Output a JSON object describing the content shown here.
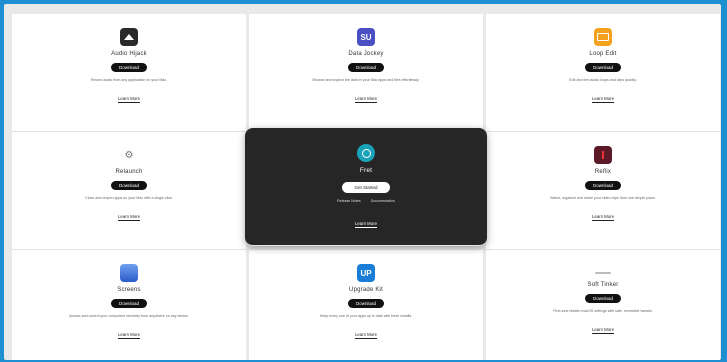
{
  "apps": [
    {
      "name": "Audio Hijack",
      "button": "Download",
      "description": "Record audio from any application on your Mac.",
      "link": "Learn More",
      "logo": "dark-speaker-icon",
      "color": "#2a2a2a"
    },
    {
      "name": "Data Jockey",
      "button": "Download",
      "description": "Browse and inspect the data in your Mac apps and files effortlessly.",
      "link": "Learn More",
      "logo": "su-icon",
      "color": "#4a4fc4",
      "logo_text": "SU"
    },
    {
      "name": "Loop Edit",
      "button": "Download",
      "description": "Edit and trim audio loops and clips quickly.",
      "link": "Learn More",
      "logo": "orange-app-icon",
      "color": "#f3a21e"
    },
    {
      "name": "Relaunch",
      "button": "Download",
      "description": "Close and reopen apps on your Mac with a single click.",
      "link": "Learn More",
      "logo": "crosshair-icon",
      "color": "#888888",
      "logo_text": "⚙"
    },
    {
      "name": "Fret",
      "button": "Get Started",
      "description": "",
      "link": "Learn More",
      "logo": "teal-circle-icon",
      "color": "#1aa3b8",
      "links_row": [
        "Release Notes",
        "Documentation"
      ]
    },
    {
      "name": "Reflix",
      "button": "Download",
      "description": "Watch, organize and share your video clips from one simple place.",
      "link": "Learn More",
      "logo": "red-dark-icon",
      "color": "#5c1a28"
    },
    {
      "name": "Screens",
      "button": "Download",
      "description": "Access and control your computers remotely from anywhere on any device.",
      "link": "Learn More",
      "logo": "blue-gradient-icon",
      "color": "#3a6fd8"
    },
    {
      "name": "Upgrade Kit",
      "button": "Download",
      "description": "Keep every one of your apps up to date with fresh installs.",
      "link": "Learn More",
      "logo": "up-icon",
      "color": "#1a7ed8",
      "logo_text": "UP"
    },
    {
      "name": "Soft Tinker",
      "button": "Download",
      "description": "Fine-tune hidden macOS settings with safe, reversible tweaks.",
      "link": "Learn More",
      "logo": "thin-bar-icon",
      "color": "#bbbbbb"
    }
  ]
}
